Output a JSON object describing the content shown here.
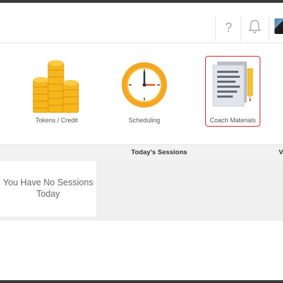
{
  "header": {
    "help_glyph": "?",
    "help_icon": "question-mark-icon",
    "notifications_icon": "bell-icon"
  },
  "tiles": [
    {
      "label": "Tokens / Credit",
      "icon": "coin-stacks-icon"
    },
    {
      "label": "Scheduling",
      "icon": "clock-icon"
    },
    {
      "label": "Coach Materials",
      "icon": "document-pencil-icon",
      "selected": true
    }
  ],
  "sessions": {
    "title": "Today's Sessions",
    "next_heading_fragment": "V",
    "empty_message": "You Have No Sessions Today"
  },
  "colors": {
    "selection_border": "#d23030",
    "coin_gold": "#f6b71d",
    "clock_orange": "#f5a623"
  }
}
